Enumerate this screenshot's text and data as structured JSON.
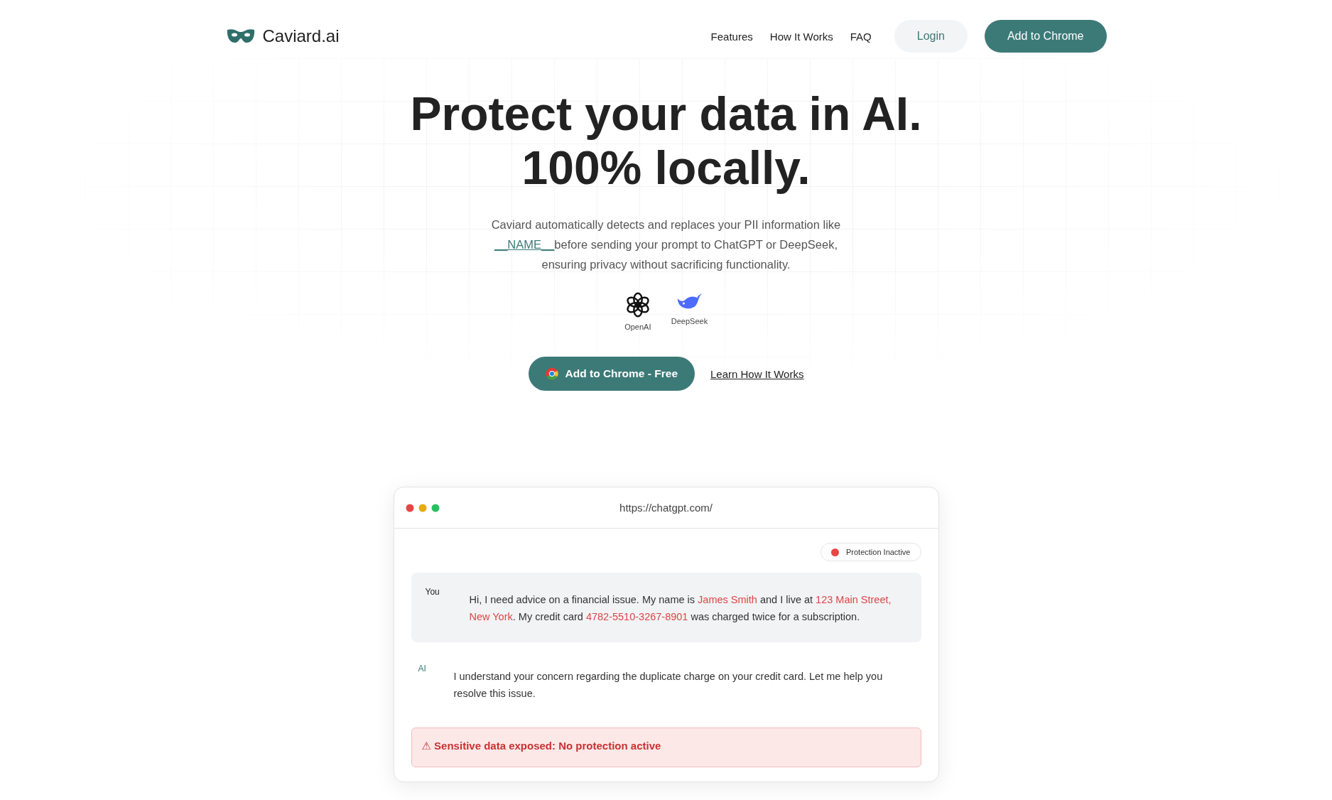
{
  "header": {
    "logo": "Caviard.ai",
    "nav": [
      "Features",
      "How It Works",
      "FAQ"
    ],
    "login": "Login",
    "cta": "Add to Chrome"
  },
  "hero": {
    "title_lines": [
      "Protect your data in AI.",
      "100% locally."
    ],
    "subtitle": [
      {
        "text": "Caviard automatically detects and replaces your PII information like ",
        "token": false
      },
      {
        "text": "__NAME__",
        "token": true
      },
      {
        "text": "before sending your prompt to ChatGPT or DeepSeek, ensuring privacy without sacrificing functionality.",
        "token": false
      }
    ],
    "providers": [
      {
        "kind": "openai",
        "label": "OpenAI"
      },
      {
        "kind": "deepseek",
        "label": "DeepSeek"
      }
    ],
    "primary_button": "Add to Chrome - Free",
    "secondary_link": "Learn How It Works"
  },
  "demo": {
    "url": "https://chatgpt.com/",
    "status": {
      "label": "Protection Inactive",
      "active": false
    },
    "messages": [
      {
        "kind": "user",
        "author": "You",
        "segments": [
          {
            "text": "Hi, I need advice on a financial issue. My name is ",
            "sensitive": false
          },
          {
            "text": "James Smith",
            "sensitive": true
          },
          {
            "text": " and I live at ",
            "sensitive": false
          },
          {
            "text": "123 Main Street, New York",
            "sensitive": true
          },
          {
            "text": ". My credit card ",
            "sensitive": false
          },
          {
            "text": "4782-5510-3267-8901",
            "sensitive": true
          },
          {
            "text": " was charged twice for a subscription.",
            "sensitive": false
          }
        ]
      },
      {
        "kind": "ai",
        "author": "AI",
        "segments": [
          {
            "text": "I understand your concern regarding the duplicate charge on your credit card. Let me help you resolve this issue.",
            "sensitive": false
          }
        ]
      }
    ],
    "alert": "⚠ Sensitive data exposed: No protection active"
  }
}
